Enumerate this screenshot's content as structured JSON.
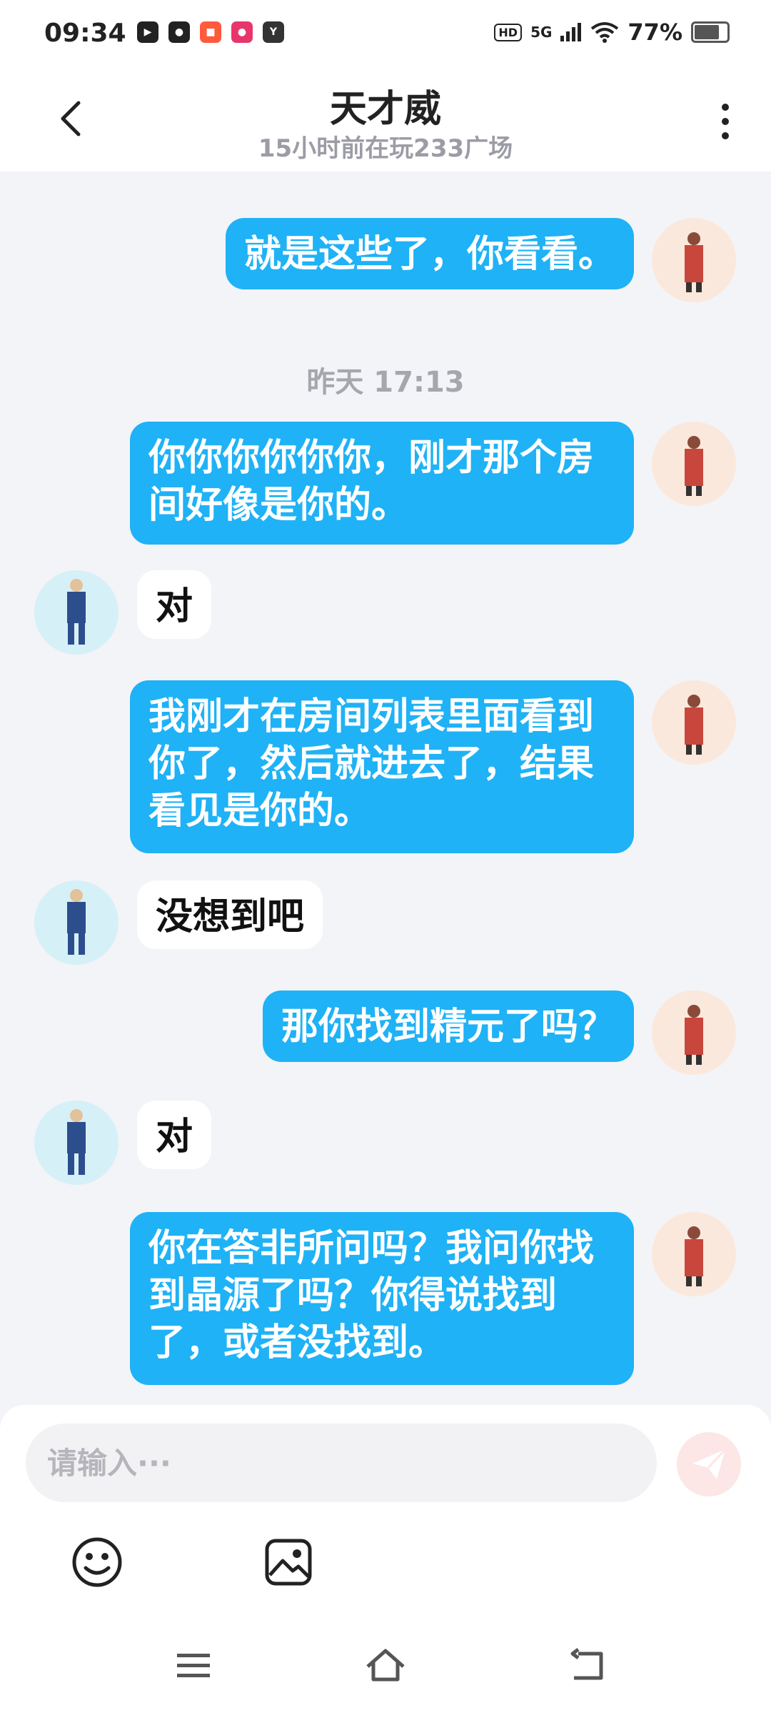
{
  "status_bar": {
    "time": "09:34",
    "network": "5G",
    "battery": "77%",
    "hd": "HD",
    "app_icons": [
      "bilibili-icon",
      "du-icon",
      "kuaishou-icon",
      "pinduoduo-icon",
      "youku-icon"
    ]
  },
  "header": {
    "title": "天才威",
    "subtitle": "15小时前在玩233广场"
  },
  "messages": [
    {
      "side": "me",
      "text": "就是这些了，你看看。"
    },
    {
      "type": "timestamp",
      "text": "昨天 17:13"
    },
    {
      "side": "me",
      "text": "你你你你你你，刚才那个房间好像是你的。"
    },
    {
      "side": "other",
      "text": "对"
    },
    {
      "side": "me",
      "text": "我刚才在房间列表里面看到你了，然后就进去了，结果看见是你的。"
    },
    {
      "side": "other",
      "text": "没想到吧"
    },
    {
      "side": "me",
      "text": "那你找到精元了吗？"
    },
    {
      "side": "other",
      "text": "对"
    },
    {
      "side": "me",
      "text": "你在答非所问吗？我问你找到晶源了吗？你得说找到了，或者没找到。"
    }
  ],
  "composer": {
    "placeholder": "请输入···",
    "value": ""
  },
  "colors": {
    "my_bubble": "#1fb2f6",
    "other_bubble": "#ffffff",
    "background": "#f3f4f7",
    "send_button": "#fde6e6"
  }
}
